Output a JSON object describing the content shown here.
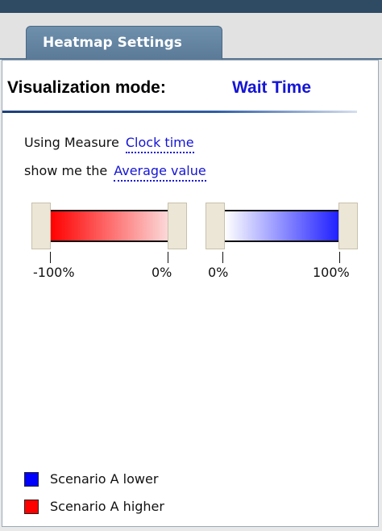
{
  "tab": {
    "label": "Heatmap Settings"
  },
  "header": {
    "label": "Visualization mode:",
    "value": "Wait Time"
  },
  "measure": {
    "prefix": "Using Measure",
    "value": "Clock time",
    "show_prefix": "show me the",
    "show_value": "Average value"
  },
  "ranges": {
    "negative": {
      "low_label": "-100%",
      "high_label": "0%",
      "color_from": "#ff0000",
      "color_to": "#fce4e4"
    },
    "positive": {
      "low_label": "0%",
      "high_label": "100%",
      "color_from": "#ffffff",
      "color_to": "#2020ff"
    }
  },
  "legend": [
    {
      "label": "Scenario A lower",
      "color": "#0000ff"
    },
    {
      "label": "Scenario A higher",
      "color": "#ff0000"
    }
  ]
}
